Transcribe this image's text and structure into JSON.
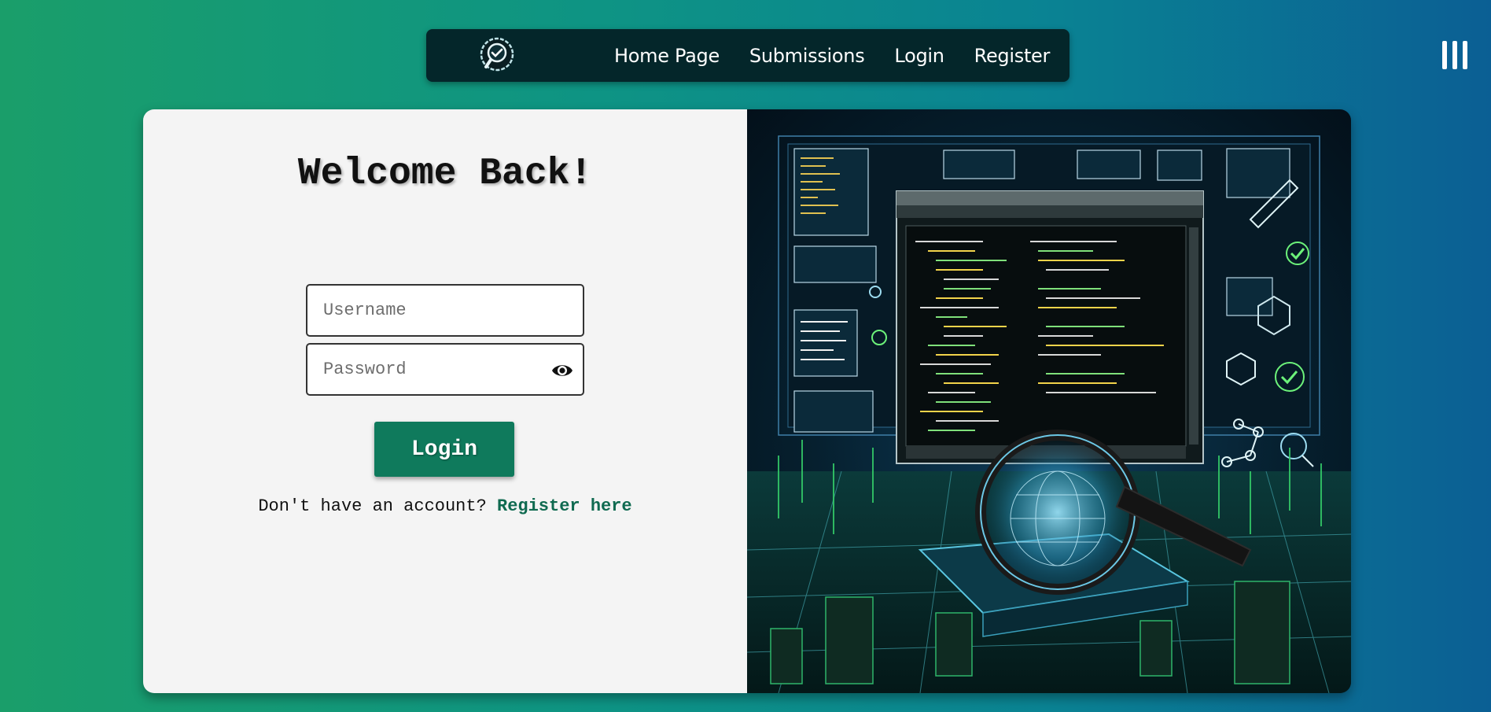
{
  "nav": {
    "logo_icon": "magnifier-check-logo-icon",
    "links": [
      {
        "label": "Home Page"
      },
      {
        "label": "Submissions"
      },
      {
        "label": "Login"
      },
      {
        "label": "Register"
      }
    ],
    "menu_icon": "hamburger-menu-icon"
  },
  "login_form": {
    "title": "Welcome Back!",
    "username": {
      "placeholder": "Username",
      "value": ""
    },
    "password": {
      "placeholder": "Password",
      "value": "",
      "toggle_icon": "eye-icon"
    },
    "submit_label": "Login",
    "register_prompt": "Don't have an account?",
    "register_link": "Register here"
  },
  "illustration": {
    "subject": "code-review-magnifier-illustration"
  },
  "colors": {
    "accent": "#0f7a5c",
    "nav_bg": "#04262a",
    "bg_gradient_start": "#1a9e6a",
    "bg_gradient_end": "#0b5f94"
  }
}
